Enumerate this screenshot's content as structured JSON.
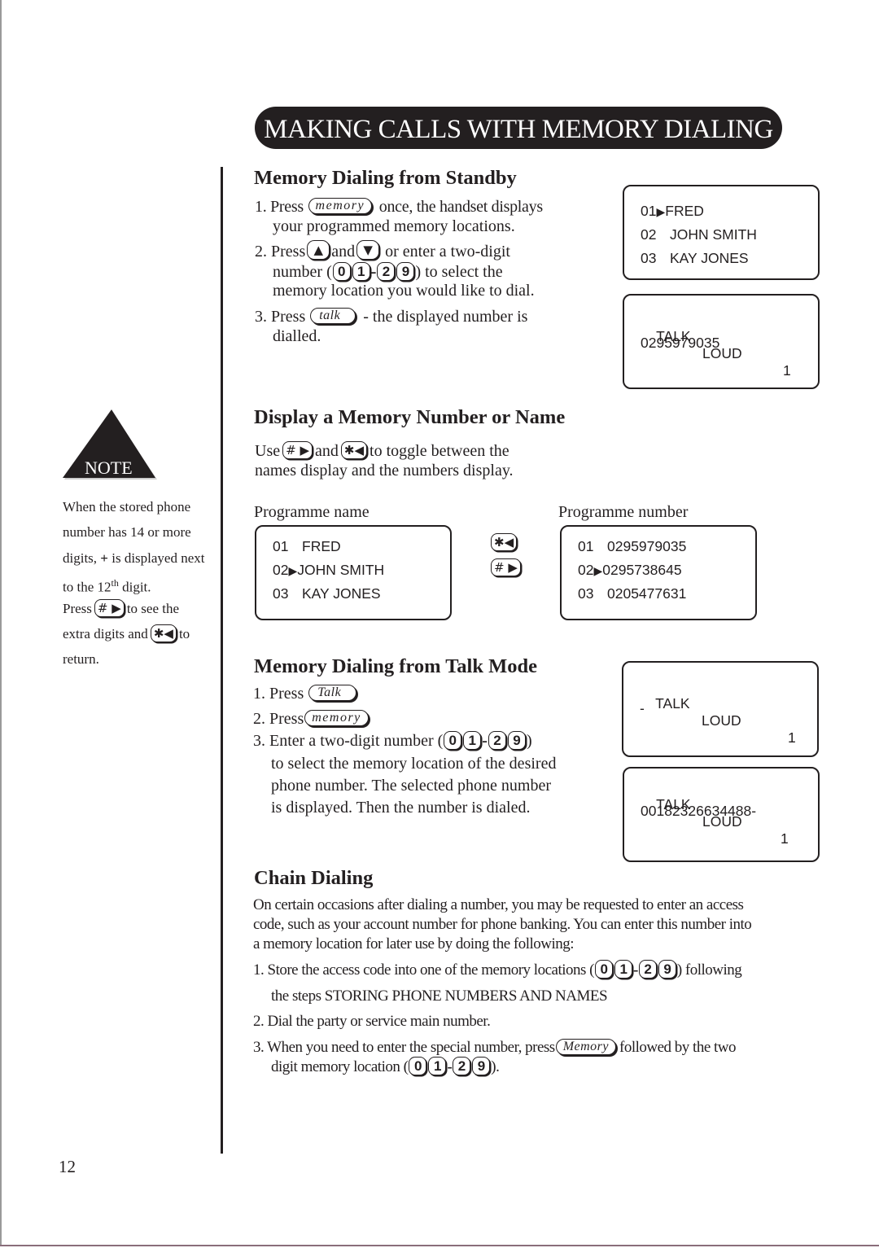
{
  "title": "MAKING CALLS WITH MEMORY DIALING",
  "page_number": "12",
  "keys": {
    "memory": "memory",
    "Memory": "Memory",
    "talk": "talk",
    "Talk": "Talk",
    "d0": "0",
    "d1": "1",
    "d2": "2",
    "d9": "9",
    "hash": "#",
    "star": "✱",
    "up_arrow": "▲",
    "down_arrow": "▼",
    "right_arrow": "▶",
    "left_arrow": "◀",
    "dash": "-"
  },
  "standby": {
    "heading": "Memory Dialing from Standby",
    "step1_a": "1. Press",
    "step1_b": "once, the handset displays",
    "step1_c": "your programmed memory locations.",
    "step2_a": "2.  Press",
    "step2_and": "and",
    "step2_b": "or enter a two-digit",
    "step2_c": "number (",
    "step2_d": ") to select the",
    "step2_e": "memory location you would like to dial.",
    "step3_a": "3. Press",
    "step3_b": "- the displayed number is",
    "step3_c": "dialled.",
    "display1": {
      "rows": [
        {
          "num": "01",
          "marker": "▶",
          "name": "FRED"
        },
        {
          "num": "02",
          "marker": "",
          "name": "JOHN SMITH"
        },
        {
          "num": "03",
          "marker": "",
          "name": "KAY JONES"
        }
      ]
    },
    "display2": {
      "mode": "TALK",
      "volume": "LOUD",
      "line": "1",
      "number": "0295979035"
    }
  },
  "display_memory": {
    "heading": "Display a Memory Number or Name",
    "text_a": "Use",
    "text_and": "and",
    "text_b": "to toggle between the",
    "text_c": "names display and the numbers display.",
    "label_name": "Programme name",
    "label_number": "Programme number",
    "name_display": {
      "rows": [
        {
          "num": "01",
          "marker": "",
          "value": "FRED"
        },
        {
          "num": "02",
          "marker": "▶",
          "value": "JOHN SMITH"
        },
        {
          "num": "03",
          "marker": "",
          "value": "KAY JONES"
        }
      ]
    },
    "number_display": {
      "rows": [
        {
          "num": "01",
          "marker": "",
          "value": "0295979035"
        },
        {
          "num": "02",
          "marker": "▶",
          "value": "0295738645"
        },
        {
          "num": "03",
          "marker": "",
          "value": "0205477631"
        }
      ]
    }
  },
  "note": {
    "label": "NOTE",
    "line1": "When the stored phone",
    "line2": "number has 14 or more",
    "line3_a": "digits,",
    "line3_plus": "+",
    "line3_b": "is displayed next",
    "line4_a": "to the 12",
    "line4_sup": "th",
    "line4_b": "digit.",
    "line5_a": "Press",
    "line5_b": "to see the",
    "line6_a": "extra digits and",
    "line6_b": "to",
    "line7": "return."
  },
  "talk_mode": {
    "heading": "Memory Dialing from Talk Mode",
    "step1": "1. Press",
    "step2": "2. Press",
    "step3_a": "3. Enter a two-digit number (",
    "step3_b": ")",
    "step3_c": "to select the memory location of the desired",
    "step3_d": "phone number. The selected phone number",
    "step3_e": "is displayed. Then the number is dialed.",
    "display1": {
      "mode": "TALK",
      "volume": "LOUD",
      "line": "1",
      "number": "-"
    },
    "display2": {
      "mode": "TALK",
      "volume": "LOUD",
      "line": "1",
      "number": "00182326634488-"
    }
  },
  "chain": {
    "heading": "Chain Dialing",
    "para1": "On certain occasions after dialing a number, you may be requested to enter an access",
    "para2": "code, such as your account number for phone banking. You can enter this number into",
    "para3": "a memory location for later use by doing the following:",
    "step1_a": "1. Store the access code into one of the memory locations (",
    "step1_b": ") following",
    "step1_c": "the steps STORING PHONE NUMBERS AND NAMES",
    "step2": "2. Dial the party or service main number.",
    "step3_a": "3. When you need to enter the special number, press",
    "step3_b": "followed by the two",
    "step3_c": "digit memory location (",
    "step3_d": ")."
  }
}
